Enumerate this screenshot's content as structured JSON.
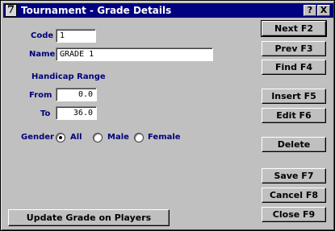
{
  "window": {
    "title": "Tournament - Grade Details",
    "app_icon_glyph": "7",
    "help_glyph": "?",
    "close_glyph": "X"
  },
  "form": {
    "code_label": "Code",
    "code_value": "1",
    "name_label": "Name",
    "name_value": "GRADE 1",
    "handicap_range_label": "Handicap Range",
    "from_label": "From",
    "from_value": "0.0",
    "to_label": "To",
    "to_value": "36.0",
    "gender_label": "Gender",
    "gender_options": [
      "All",
      "Male",
      "Female"
    ],
    "gender_selected": "All"
  },
  "buttons": {
    "next": "Next F2",
    "prev": "Prev F3",
    "find": "Find F4",
    "insert": "Insert F5",
    "edit": "Edit F6",
    "delete": "Delete",
    "save": "Save F7",
    "cancel": "Cancel F8",
    "close": "Close F9",
    "update_grade": "Update Grade on Players"
  },
  "colors": {
    "titlebar": "#000080",
    "label_text": "#00007b",
    "face": "#c0c0c0"
  }
}
